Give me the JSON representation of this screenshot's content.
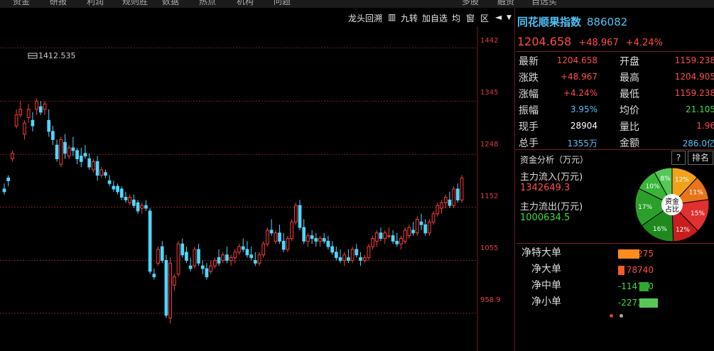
{
  "menubar": {
    "items": [
      "资金",
      "研报",
      "利润",
      "规则胜",
      "数据",
      "热点",
      "机构",
      "问题",
      "",
      "",
      "多股",
      "融资",
      "自选买"
    ]
  },
  "toolbar": {
    "items": [
      {
        "label": "龙头回溯",
        "icon": ""
      },
      {
        "label": "",
        "icon": "square-icon"
      },
      {
        "label": "九转",
        "icon": ""
      },
      {
        "label": "加自选",
        "icon": ""
      },
      {
        "label": "均",
        "icon": ""
      },
      {
        "label": "窗",
        "icon": ""
      },
      {
        "label": "区",
        "icon": ""
      },
      {
        "label": "",
        "icon": "flag-icon"
      },
      {
        "label": "",
        "icon": "chevron-down-icon"
      }
    ]
  },
  "chart": {
    "high_label": "1412.535",
    "price_axis": [
      "1442",
      "1345",
      "1248",
      "1152",
      "1055",
      "958.9"
    ],
    "colors": {
      "up": "#ff3b3b",
      "down": "#4fd6ff",
      "grid": "#7a1f1f"
    }
  },
  "chart_data": {
    "type": "candlestick",
    "ylim": [
      890,
      1480
    ],
    "annotation": "1412.535",
    "ohlc": [
      [
        1185,
        1195,
        1175,
        1180
      ],
      [
        1205,
        1210,
        1190,
        1200
      ],
      [
        1240,
        1255,
        1235,
        1250
      ],
      [
        1300,
        1330,
        1295,
        1320
      ],
      [
        1320,
        1345,
        1315,
        1330
      ],
      [
        1285,
        1310,
        1275,
        1305
      ],
      [
        1315,
        1340,
        1305,
        1330
      ],
      [
        1310,
        1325,
        1290,
        1300
      ],
      [
        1330,
        1350,
        1320,
        1345
      ],
      [
        1335,
        1345,
        1320,
        1325
      ],
      [
        1330,
        1345,
        1320,
        1340
      ],
      [
        1310,
        1330,
        1280,
        1290
      ],
      [
        1290,
        1300,
        1265,
        1275
      ],
      [
        1265,
        1275,
        1235,
        1240
      ],
      [
        1230,
        1280,
        1225,
        1275
      ],
      [
        1270,
        1285,
        1240,
        1250
      ],
      [
        1245,
        1265,
        1240,
        1260
      ],
      [
        1260,
        1280,
        1245,
        1255
      ],
      [
        1255,
        1260,
        1230,
        1240
      ],
      [
        1245,
        1260,
        1225,
        1235
      ],
      [
        1250,
        1265,
        1240,
        1245
      ],
      [
        1240,
        1250,
        1220,
        1225
      ],
      [
        1220,
        1240,
        1215,
        1235
      ],
      [
        1235,
        1245,
        1200,
        1210
      ],
      [
        1210,
        1225,
        1205,
        1220
      ],
      [
        1215,
        1220,
        1205,
        1210
      ],
      [
        1200,
        1210,
        1190,
        1195
      ],
      [
        1190,
        1200,
        1180,
        1185
      ],
      [
        1190,
        1195,
        1175,
        1180
      ],
      [
        1185,
        1190,
        1165,
        1170
      ],
      [
        1170,
        1180,
        1160,
        1165
      ],
      [
        1160,
        1175,
        1155,
        1170
      ],
      [
        1165,
        1175,
        1150,
        1155
      ],
      [
        1160,
        1165,
        1140,
        1145
      ],
      [
        1150,
        1160,
        1140,
        1155
      ],
      [
        1155,
        1165,
        1145,
        1150
      ],
      [
        1145,
        1150,
        1030,
        1035
      ],
      [
        1030,
        1040,
        1020,
        1025
      ],
      [
        1050,
        1080,
        1045,
        1075
      ],
      [
        1080,
        1090,
        1050,
        1055
      ],
      [
        1055,
        1065,
        950,
        955
      ],
      [
        950,
        1060,
        940,
        1050
      ],
      [
        1010,
        1030,
        1000,
        1025
      ],
      [
        1030,
        1090,
        1025,
        1085
      ],
      [
        1085,
        1095,
        1060,
        1065
      ],
      [
        1070,
        1080,
        1050,
        1055
      ],
      [
        1045,
        1060,
        1035,
        1040
      ],
      [
        1045,
        1080,
        1040,
        1075
      ],
      [
        1075,
        1085,
        1045,
        1050
      ],
      [
        1045,
        1055,
        1030,
        1040
      ],
      [
        1040,
        1050,
        1020,
        1025
      ],
      [
        1035,
        1055,
        1030,
        1045
      ],
      [
        1045,
        1060,
        1040,
        1055
      ],
      [
        1060,
        1075,
        1045,
        1050
      ],
      [
        1055,
        1070,
        1050,
        1065
      ],
      [
        1065,
        1080,
        1050,
        1055
      ],
      [
        1055,
        1065,
        1045,
        1060
      ],
      [
        1060,
        1075,
        1050,
        1070
      ],
      [
        1070,
        1085,
        1065,
        1080
      ],
      [
        1080,
        1095,
        1070,
        1075
      ],
      [
        1075,
        1090,
        1060,
        1065
      ],
      [
        1065,
        1080,
        1055,
        1060
      ],
      [
        1055,
        1070,
        1045,
        1050
      ],
      [
        1050,
        1070,
        1045,
        1065
      ],
      [
        1065,
        1090,
        1060,
        1085
      ],
      [
        1085,
        1115,
        1080,
        1110
      ],
      [
        1110,
        1130,
        1100,
        1105
      ],
      [
        1090,
        1110,
        1085,
        1105
      ],
      [
        1105,
        1120,
        1085,
        1090
      ],
      [
        1090,
        1105,
        1070,
        1075
      ],
      [
        1075,
        1100,
        1070,
        1095
      ],
      [
        1095,
        1130,
        1090,
        1125
      ],
      [
        1125,
        1160,
        1120,
        1155
      ],
      [
        1155,
        1165,
        1110,
        1115
      ],
      [
        1115,
        1130,
        1085,
        1090
      ],
      [
        1090,
        1105,
        1080,
        1100
      ],
      [
        1100,
        1110,
        1085,
        1095
      ],
      [
        1095,
        1105,
        1080,
        1090
      ],
      [
        1090,
        1100,
        1080,
        1095
      ],
      [
        1095,
        1105,
        1085,
        1090
      ],
      [
        1090,
        1100,
        1075,
        1080
      ],
      [
        1080,
        1090,
        1065,
        1070
      ],
      [
        1070,
        1080,
        1055,
        1060
      ],
      [
        1060,
        1075,
        1050,
        1055
      ],
      [
        1055,
        1070,
        1045,
        1065
      ],
      [
        1060,
        1075,
        1050,
        1055
      ],
      [
        1055,
        1080,
        1050,
        1075
      ],
      [
        1075,
        1085,
        1060,
        1065
      ],
      [
        1060,
        1070,
        1045,
        1055
      ],
      [
        1055,
        1065,
        1050,
        1060
      ],
      [
        1060,
        1085,
        1055,
        1080
      ],
      [
        1080,
        1100,
        1075,
        1095
      ],
      [
        1090,
        1110,
        1080,
        1105
      ],
      [
        1105,
        1115,
        1090,
        1095
      ],
      [
        1095,
        1110,
        1085,
        1105
      ],
      [
        1100,
        1115,
        1095,
        1100
      ],
      [
        1100,
        1110,
        1085,
        1090
      ],
      [
        1090,
        1105,
        1080,
        1085
      ],
      [
        1085,
        1100,
        1075,
        1095
      ],
      [
        1090,
        1115,
        1085,
        1110
      ],
      [
        1100,
        1120,
        1095,
        1115
      ],
      [
        1110,
        1125,
        1100,
        1105
      ],
      [
        1105,
        1135,
        1100,
        1130
      ],
      [
        1125,
        1140,
        1110,
        1120
      ],
      [
        1120,
        1130,
        1100,
        1105
      ],
      [
        1105,
        1130,
        1100,
        1125
      ],
      [
        1125,
        1145,
        1120,
        1140
      ],
      [
        1140,
        1160,
        1135,
        1155
      ],
      [
        1150,
        1165,
        1140,
        1160
      ],
      [
        1160,
        1175,
        1150,
        1170
      ],
      [
        1165,
        1180,
        1150,
        1155
      ],
      [
        1155,
        1190,
        1150,
        1185
      ],
      [
        1185,
        1195,
        1160,
        1165
      ],
      [
        1165,
        1210,
        1160,
        1205
      ]
    ]
  },
  "quote": {
    "name": "同花顺果指数",
    "code": "886082",
    "price": "1204.658",
    "change": "+48.967",
    "change_pct": "+4.24%",
    "rows": [
      {
        "l1": "最新",
        "v1": "1204.658",
        "c1": "red",
        "l2": "开盘",
        "v2": "1159.238",
        "c2": "red"
      },
      {
        "l1": "涨跌",
        "v1": "+48.967",
        "c1": "red",
        "l2": "最高",
        "v2": "1204.905",
        "c2": "red"
      },
      {
        "l1": "涨幅",
        "v1": "+4.24%",
        "c1": "red",
        "l2": "最低",
        "v2": "1159.238",
        "c2": "red"
      },
      {
        "l1": "振幅",
        "v1": "3.95%",
        "c1": "cyan",
        "l2": "均价",
        "v2": "21.105",
        "c2": "green"
      },
      {
        "l1": "现手",
        "v1": "28904",
        "c1": "white",
        "l2": "量比",
        "v2": "1.96",
        "c2": "red"
      },
      {
        "l1": "总手",
        "v1": "1355万",
        "c1": "cyan",
        "l2": "金额",
        "v2": "286.0亿",
        "c2": "cyan"
      }
    ]
  },
  "funds": {
    "title": "资金分析（万元）",
    "help_label": "?",
    "rank_label": "排名",
    "inflow_label": "主力流入(万元)",
    "inflow_value": "1342649.3",
    "outflow_label": "主力流出(万元)",
    "outflow_value": "1000634.5",
    "pie_center": "资金占比",
    "pie": [
      {
        "pct": 12,
        "label": "12%",
        "color": "#f0a21c"
      },
      {
        "pct": 11,
        "label": "11%",
        "color": "#e8751a"
      },
      {
        "pct": 15,
        "label": "15%",
        "color": "#e03030"
      },
      {
        "pct": 12,
        "label": "12%",
        "color": "#c81e1e"
      },
      {
        "pct": 16,
        "label": "16%",
        "color": "#1e8a1e"
      },
      {
        "pct": 17,
        "label": "17%",
        "color": "#2aa02a"
      },
      {
        "pct": 10,
        "label": "10%",
        "color": "#3ab53a"
      },
      {
        "pct": 8,
        "label": "8%",
        "color": "#55c855"
      }
    ]
  },
  "net": [
    {
      "label": "净特大单",
      "value": "263275",
      "color": "#ff8c1a",
      "bar": 263275
    },
    {
      "label": "净大单",
      "value": "78740",
      "color": "#ff5a2a",
      "bar": 78740
    },
    {
      "label": "净中单",
      "value": "-114710",
      "color": "#2ea82e",
      "bar": -114710
    },
    {
      "label": "净小单",
      "value": "-227305",
      "color": "#55c855",
      "bar": -227305
    }
  ]
}
